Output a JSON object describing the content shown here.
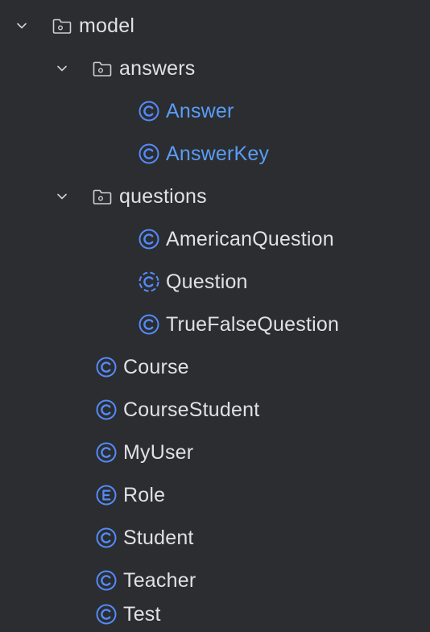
{
  "colors": {
    "background": "#2b2d30",
    "text": "#dfe1e5",
    "modified_text": "#5a9cf8",
    "class_icon": "#548af7",
    "folder_icon": "#ced0d6"
  },
  "tree": {
    "model": {
      "label": "model",
      "icon": "folder-icon",
      "expanded": true
    },
    "answers": {
      "label": "answers",
      "icon": "folder-icon",
      "expanded": true
    },
    "answer": {
      "label": "Answer",
      "icon": "class-icon"
    },
    "answer_key": {
      "label": "AnswerKey",
      "icon": "class-icon"
    },
    "questions": {
      "label": "questions",
      "icon": "folder-icon",
      "expanded": true
    },
    "american_question": {
      "label": "AmericanQuestion",
      "icon": "class-icon"
    },
    "question": {
      "label": "Question",
      "icon": "abstract-class-icon"
    },
    "true_false_question": {
      "label": "TrueFalseQuestion",
      "icon": "class-icon"
    },
    "course": {
      "label": "Course",
      "icon": "class-icon"
    },
    "course_student": {
      "label": "CourseStudent",
      "icon": "class-icon"
    },
    "my_user": {
      "label": "MyUser",
      "icon": "class-icon"
    },
    "role": {
      "label": "Role",
      "icon": "enum-icon"
    },
    "student": {
      "label": "Student",
      "icon": "class-icon"
    },
    "teacher": {
      "label": "Teacher",
      "icon": "class-icon"
    },
    "test": {
      "label": "Test",
      "icon": "class-icon"
    }
  }
}
